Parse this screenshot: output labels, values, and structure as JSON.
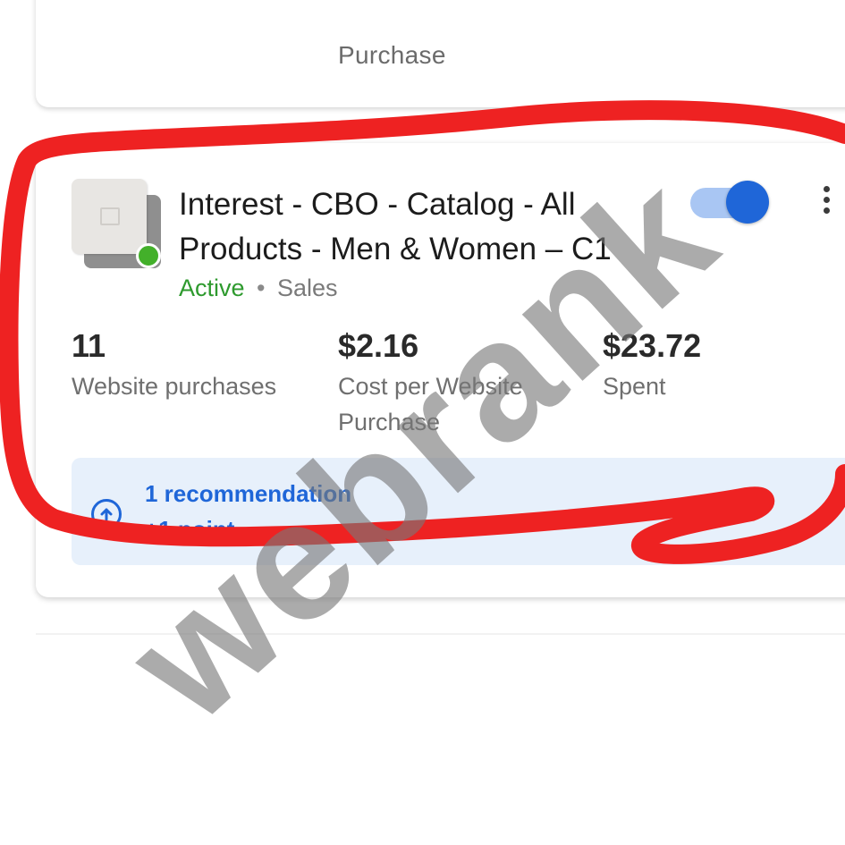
{
  "previous_card": {
    "label_fragment": "Purchase"
  },
  "campaign": {
    "title": "Interest - CBO - Catalog - All Products - Men & Women – C1",
    "status": "Active",
    "separator": "•",
    "objective": "Sales",
    "toggle_on": true,
    "status_color": "#43b02a",
    "accent_color": "#1f66d8",
    "thumbnail_icon": "image-placeholder-icon"
  },
  "metrics": [
    {
      "value": "11",
      "label": "Website purchases"
    },
    {
      "value": "$2.16",
      "label": "Cost per Website Purchase"
    },
    {
      "value": "$23.72",
      "label": "Spent"
    }
  ],
  "recommendation": {
    "icon": "arrow-up-circle-icon",
    "title": "1 recommendation",
    "subtitle": "+1 point"
  },
  "annotation": {
    "highlight_color": "#ee2222",
    "watermark_text": "webrank"
  }
}
